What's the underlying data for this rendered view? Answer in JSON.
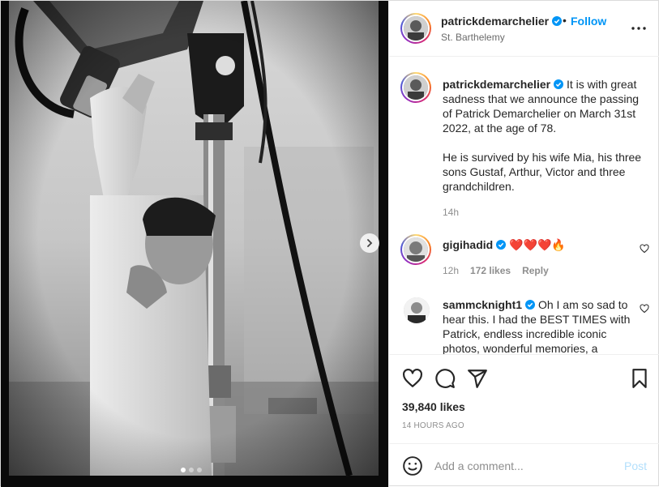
{
  "post": {
    "author": {
      "username": "patrickdemarchelier",
      "verified": true,
      "location": "St. Barthelemy",
      "follow_label": "Follow",
      "separator": "•"
    },
    "caption": {
      "username": "patrickdemarchelier",
      "paragraph1": "It is with great sadness that we announce the passing of Patrick Demarchelier on March 31st 2022, at the age of 78.",
      "paragraph2": "He is survived by his wife Mia, his three sons Gustaf, Arthur, Victor and three grandchildren.",
      "age": "14h"
    },
    "comments": [
      {
        "username": "gigihadid",
        "verified": true,
        "text": "❤️❤️❤️🔥",
        "age": "12h",
        "likes": "172 likes",
        "reply_label": "Reply"
      },
      {
        "username": "sammcknight1",
        "verified": true,
        "text": "Oh I am so sad to hear this. I had the BEST TIMES with Patrick, endless incredible iconic photos, wonderful memories, a"
      }
    ],
    "likes_count": "39,840 likes",
    "timestamp": "14 HOURS AGO",
    "comment_box": {
      "placeholder": "Add a comment...",
      "post_label": "Post"
    },
    "carousel": {
      "slides": 3,
      "active": 1
    }
  },
  "colors": {
    "link_blue": "#0095f6",
    "post_disabled": "#b2dffc",
    "verified_blue": "#0095f6",
    "heart_red": "#ed4956",
    "muted": "#8e8e8e"
  },
  "icons": [
    "chevron-right-icon",
    "more-icon",
    "verified-icon",
    "heart-icon",
    "comment-icon",
    "share-icon",
    "bookmark-icon",
    "emoji-icon"
  ]
}
